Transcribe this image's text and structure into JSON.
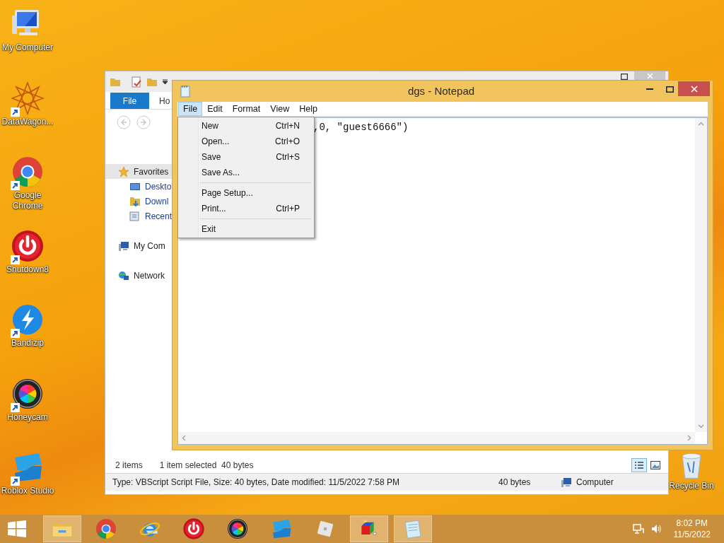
{
  "desktop_icons": [
    {
      "kind": "computer",
      "label": "My Computer",
      "shortcut": false
    },
    {
      "kind": "mandala",
      "label": "DataWagon...",
      "shortcut": true
    },
    {
      "kind": "chrome",
      "label": "Google Chrome",
      "shortcut": true
    },
    {
      "kind": "power",
      "label": "Shutdown8",
      "shortcut": true
    },
    {
      "kind": "bandizip",
      "label": "Bandizip",
      "shortcut": true
    },
    {
      "kind": "honeycam",
      "label": "Honeycam",
      "shortcut": true
    },
    {
      "kind": "studio",
      "label": "Roblox Studio",
      "shortcut": true
    }
  ],
  "recycle_bin": {
    "label": "Recycle Bin"
  },
  "explorer": {
    "ribbon_tabs": [
      {
        "label": "File",
        "kind": "file"
      },
      {
        "label": "Ho",
        "kind": "tab"
      }
    ],
    "nav_pane": [
      {
        "label": "Favorites",
        "kind": "favorites",
        "selected": true,
        "children": [
          {
            "label": "Deskto",
            "kind": "desktop",
            "selected": false
          },
          {
            "label": "Downl",
            "kind": "downloads",
            "selected": false
          },
          {
            "label": "Recent",
            "kind": "recent",
            "selected": false
          }
        ]
      },
      {
        "label": "My Com",
        "kind": "computer",
        "selected": false
      },
      {
        "label": "Network",
        "kind": "network",
        "selected": false
      }
    ],
    "item_count": "2 items",
    "selection": "1 item selected  40 bytes",
    "details": {
      "description": "Type: VBScript Script File, Size: 40 bytes, Date modified: 11/5/2022 7:58 PM",
      "size": "40 bytes",
      "location": "Computer"
    }
  },
  "notepad": {
    "title": "dgs - Notepad",
    "menu": [
      {
        "label": "File",
        "selected": true
      },
      {
        "label": "Edit",
        "selected": false
      },
      {
        "label": "Format",
        "selected": false
      },
      {
        "label": "View",
        "selected": false
      },
      {
        "label": "Help",
        "selected": false
      }
    ],
    "text": ",0, \"guest6666\")",
    "file_menu": [
      {
        "items": [
          {
            "label": "New",
            "shortcut": "Ctrl+N"
          },
          {
            "label": "Open...",
            "shortcut": "Ctrl+O"
          },
          {
            "label": "Save",
            "shortcut": "Ctrl+S"
          },
          {
            "label": "Save As..."
          }
        ]
      },
      {
        "items": [
          {
            "label": "Page Setup..."
          },
          {
            "label": "Print...",
            "shortcut": "Ctrl+P"
          }
        ]
      },
      {
        "items": [
          {
            "label": "Exit"
          }
        ]
      }
    ]
  },
  "taskbar": {
    "apps": [
      {
        "kind": "explorer",
        "running": true
      },
      {
        "kind": "chrome",
        "running": false
      },
      {
        "kind": "ie",
        "running": false
      },
      {
        "kind": "power",
        "running": false
      },
      {
        "kind": "honeycam",
        "running": false
      },
      {
        "kind": "studio",
        "running": false
      },
      {
        "kind": "roblox",
        "running": false
      },
      {
        "kind": "cube",
        "running": true
      },
      {
        "kind": "notepad",
        "running": true
      }
    ],
    "time": "8:02 PM",
    "date": "11/5/2022"
  }
}
